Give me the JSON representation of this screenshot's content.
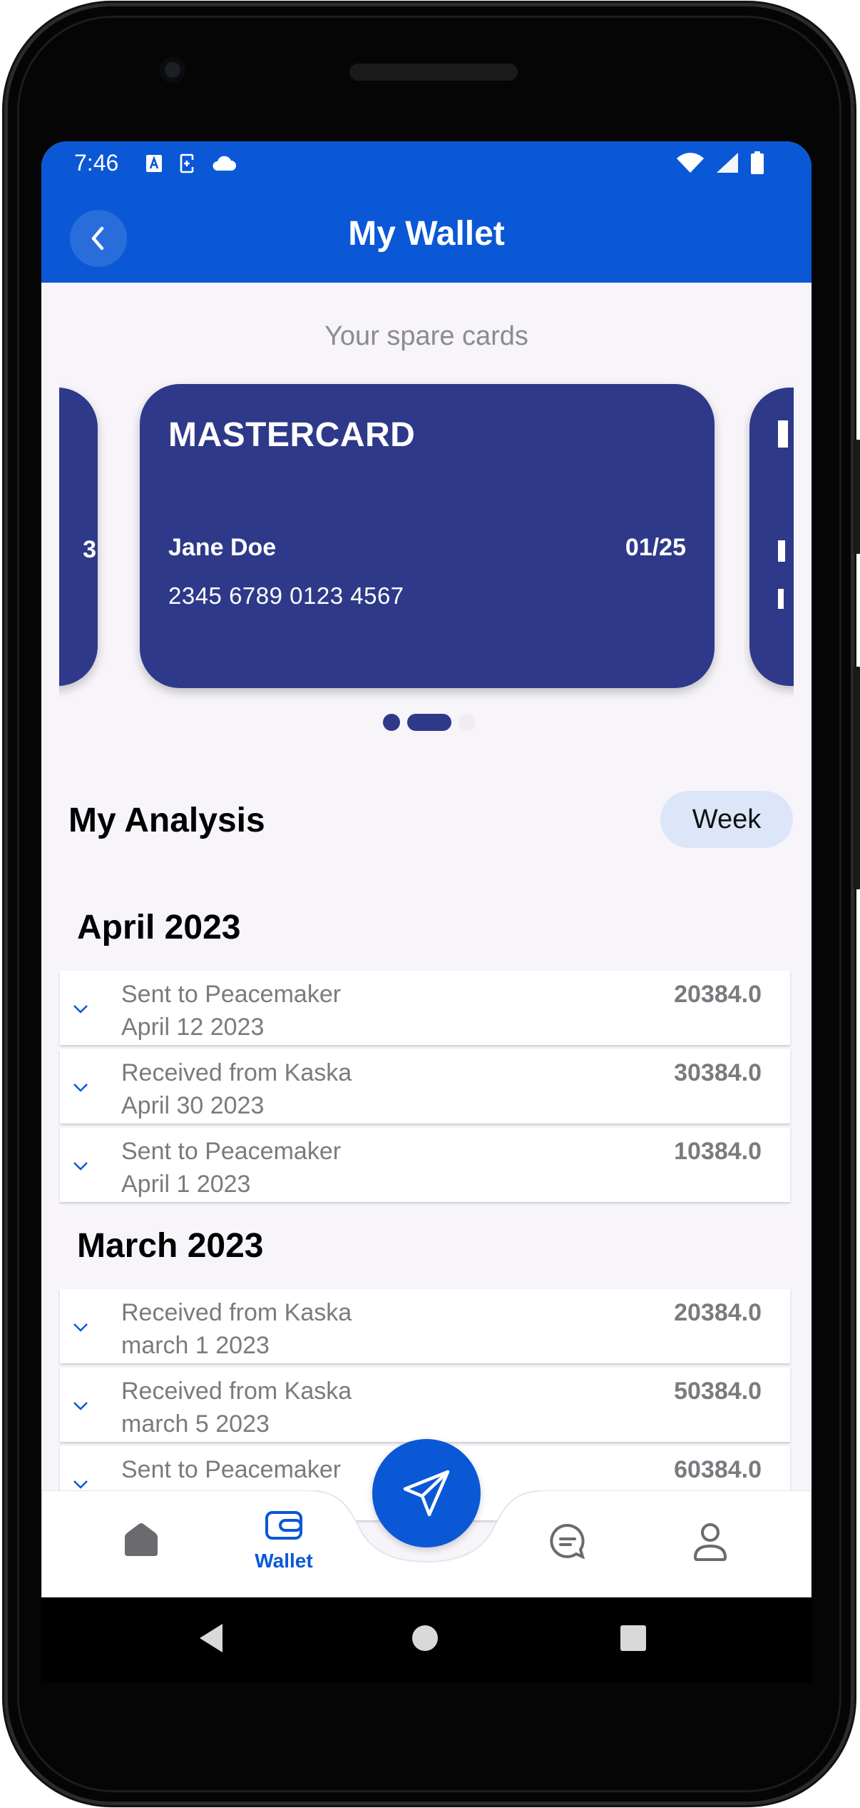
{
  "status_bar": {
    "time": "7:46",
    "left_icons": [
      "translate-icon",
      "accessibility-icon",
      "cloud-icon"
    ],
    "right_icons": [
      "wifi-icon",
      "signal-icon",
      "battery-icon"
    ]
  },
  "app_bar": {
    "title": "My Wallet",
    "back_icon": "chevron-left-icon"
  },
  "cards": {
    "heading": "Your spare cards",
    "main": {
      "brand": "MASTERCARD",
      "holder": "Jane Doe",
      "expiry": "01/25",
      "number": "2345 6789 0123 4567"
    },
    "left_peek_fragment": "3",
    "pager": {
      "count": 3,
      "active_index": 1
    }
  },
  "analysis": {
    "title": "My Analysis",
    "period_chip": "Week"
  },
  "months": [
    {
      "title": "April 2023",
      "transactions": [
        {
          "title": "Sent to Peacemaker",
          "date": "April 12 2023",
          "amount": "20384.0"
        },
        {
          "title": "Received from Kaska",
          "date": "April 30 2023",
          "amount": "30384.0"
        },
        {
          "title": "Sent to Peacemaker",
          "date": "April 1 2023",
          "amount": "10384.0"
        }
      ]
    },
    {
      "title": "March 2023",
      "transactions": [
        {
          "title": "Received from Kaska",
          "date": "march 1 2023",
          "amount": "20384.0"
        },
        {
          "title": "Received from Kaska",
          "date": "march 5 2023",
          "amount": "50384.0"
        },
        {
          "title": "Sent to Peacemaker",
          "date": "",
          "amount": "60384.0"
        }
      ]
    }
  ],
  "bottom_nav": {
    "items": [
      {
        "name": "home",
        "icon": "home-icon",
        "label": ""
      },
      {
        "name": "wallet",
        "icon": "wallet-icon",
        "label": "Wallet",
        "active": true
      },
      {
        "name": "messages",
        "icon": "chat-icon",
        "label": ""
      },
      {
        "name": "profile",
        "icon": "user-icon",
        "label": ""
      }
    ],
    "fab_icon": "send-icon"
  },
  "colors": {
    "primary": "#0a58d6",
    "card": "#2f3989",
    "background": "#f7f5fa",
    "chip": "#dde6f8",
    "muted_text": "#7b7a80"
  }
}
